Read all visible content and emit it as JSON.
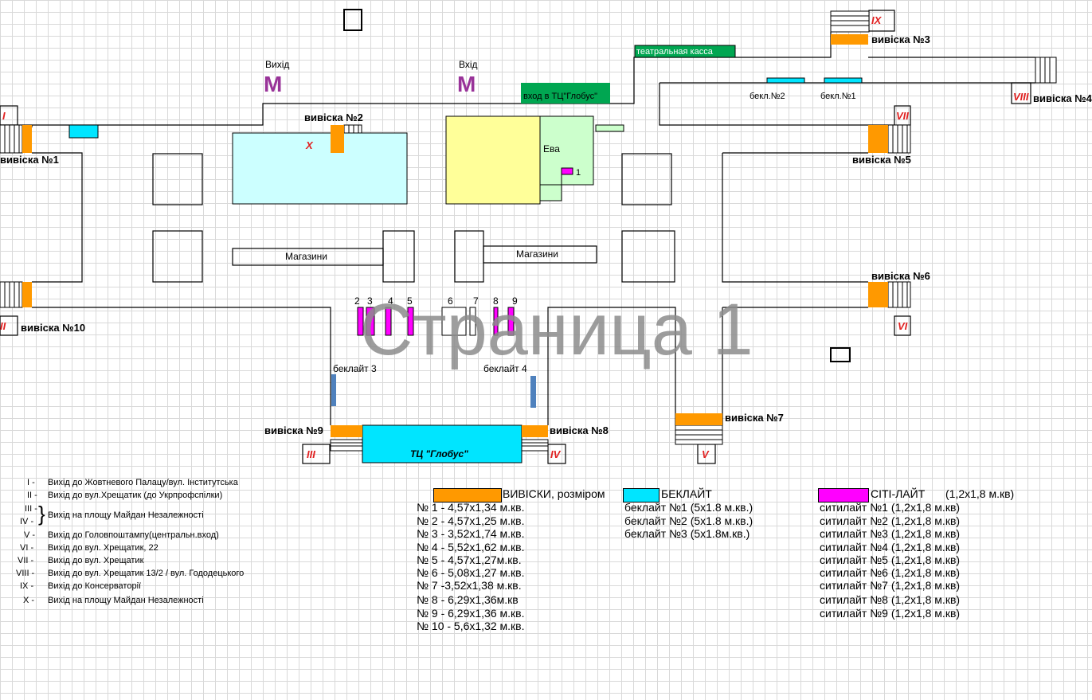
{
  "colors": {
    "signs": "#ff9900",
    "backlight": "#00e5ff",
    "citylight": "#ff00ff",
    "theatre": "#00a651",
    "shops_blue": "#ccffff",
    "yellow": "#ffff99",
    "eva_green": "#ccffcc",
    "backlight_blue": "#4f81bd",
    "roman_red": "#e02020",
    "metro": "#993399"
  },
  "watermark": "Страница 1",
  "map": {
    "metro_exit_left": "Вихід",
    "metro_exit_right": "Вхід",
    "metro_symbol": "M",
    "globus_entrance": "вход в ТЦ\"Глобус\"",
    "theatre_box_office": "театральная касса",
    "eva": "Ева",
    "citylight_1": "1",
    "shops_1": "Магазини",
    "shops_2": "Магазини",
    "mall": "ТЦ \"Глобус\"",
    "backlight_3": "беклайт 3",
    "backlight_4": "беклайт 4",
    "bekl_2": "бекл.№2",
    "bekl_1": "бекл.№1",
    "citylight_numbers": [
      "2",
      "3",
      "4",
      "5",
      "6",
      "7",
      "8",
      "9"
    ],
    "signs": {
      "s1": "вивіска №1",
      "s2": "вивіска №2",
      "s3": "вивіска №3",
      "s4": "вивіска №4",
      "s5": "вивіска №5",
      "s6": "вивіска №6",
      "s7": "вивіска №7",
      "s8": "вивіска №8",
      "s9": "вивіска №9",
      "s10": "вивіска №10"
    },
    "exits": {
      "I": "I",
      "II": "II",
      "III": "III",
      "IV": "IV",
      "V": "V",
      "VI": "VI",
      "VII": "VII",
      "VIII": "VIII",
      "IX": "IX",
      "X": "X"
    }
  },
  "exit_legend": [
    {
      "num": "I -",
      "text": "Вихід до Жовтневого Палацу/вул. Інститутська"
    },
    {
      "num": "II -",
      "text": "Вихід до вул.Хрещатик (до Укрпрофспілки)"
    },
    {
      "num": "III -",
      "text": ""
    },
    {
      "num": "IV -",
      "text": ""
    },
    {
      "num": "V -",
      "text": "Вихід до Головпоштампу(центральн.вход)"
    },
    {
      "num": "VI -",
      "text": "Вихід до вул. Хрещатик, 22"
    },
    {
      "num": "VII -",
      "text": "Вихід до вул. Хрещатик"
    },
    {
      "num": "VIII -",
      "text": "Вихід до вул. Хрещатик 13/2 / вул. Гододецького"
    },
    {
      "num": "IX -",
      "text": "Вихід до Консерваторії"
    },
    {
      "num": "X -",
      "text": "Вихід на площу Майдан Незалежності"
    }
  ],
  "exit_legend_grouped": "Вихід на площу Майдан Незалежності",
  "legend": {
    "signs_title": "ВИВІСКИ, розміром",
    "backlight_title": "БЕКЛАЙТ",
    "citylight_title": "СІТІ-ЛАЙТ",
    "citylight_size": "(1,2х1,8 м.кв)"
  },
  "signs_sizes": [
    "№ 1 - 4,57х1,34 м.кв.",
    "№ 2 - 4,57х1,25 м.кв.",
    "№ 3 - 3,52х1,74 м.кв.",
    "№ 4 - 5,52х1,62 м.кв.",
    "№ 5 - 4,57х1,27м.кв.",
    "№ 6 - 5,08х1,27 м.кв.",
    "№ 7 -3,52х1,38 м.кв.",
    "№ 8 - 6,29х1,36м.кв",
    "№ 9 - 6,29х1,36 м.кв.",
    "№ 10 - 5,6х1,32 м.кв."
  ],
  "backlight_sizes": [
    "беклайт №1 (5х1.8 м.кв.)",
    "беклайт №2 (5х1.8 м.кв.)",
    "беклайт №3 (5х1.8м.кв.)"
  ],
  "citylight_sizes": [
    "ситилайт №1 (1,2х1,8 м.кв)",
    "ситилайт №2 (1,2х1,8 м.кв)",
    "ситилайт №3 (1,2х1,8 м.кв)",
    "ситилайт №4 (1,2х1,8 м.кв)",
    "ситилайт №5 (1,2х1,8 м.кв)",
    "ситилайт №6 (1,2х1,8 м.кв)",
    "ситилайт №7 (1,2х1,8 м.кв)",
    "ситилайт №8 (1,2х1,8 м.кв)",
    "ситилайт №9 (1,2х1,8 м.кв)"
  ]
}
